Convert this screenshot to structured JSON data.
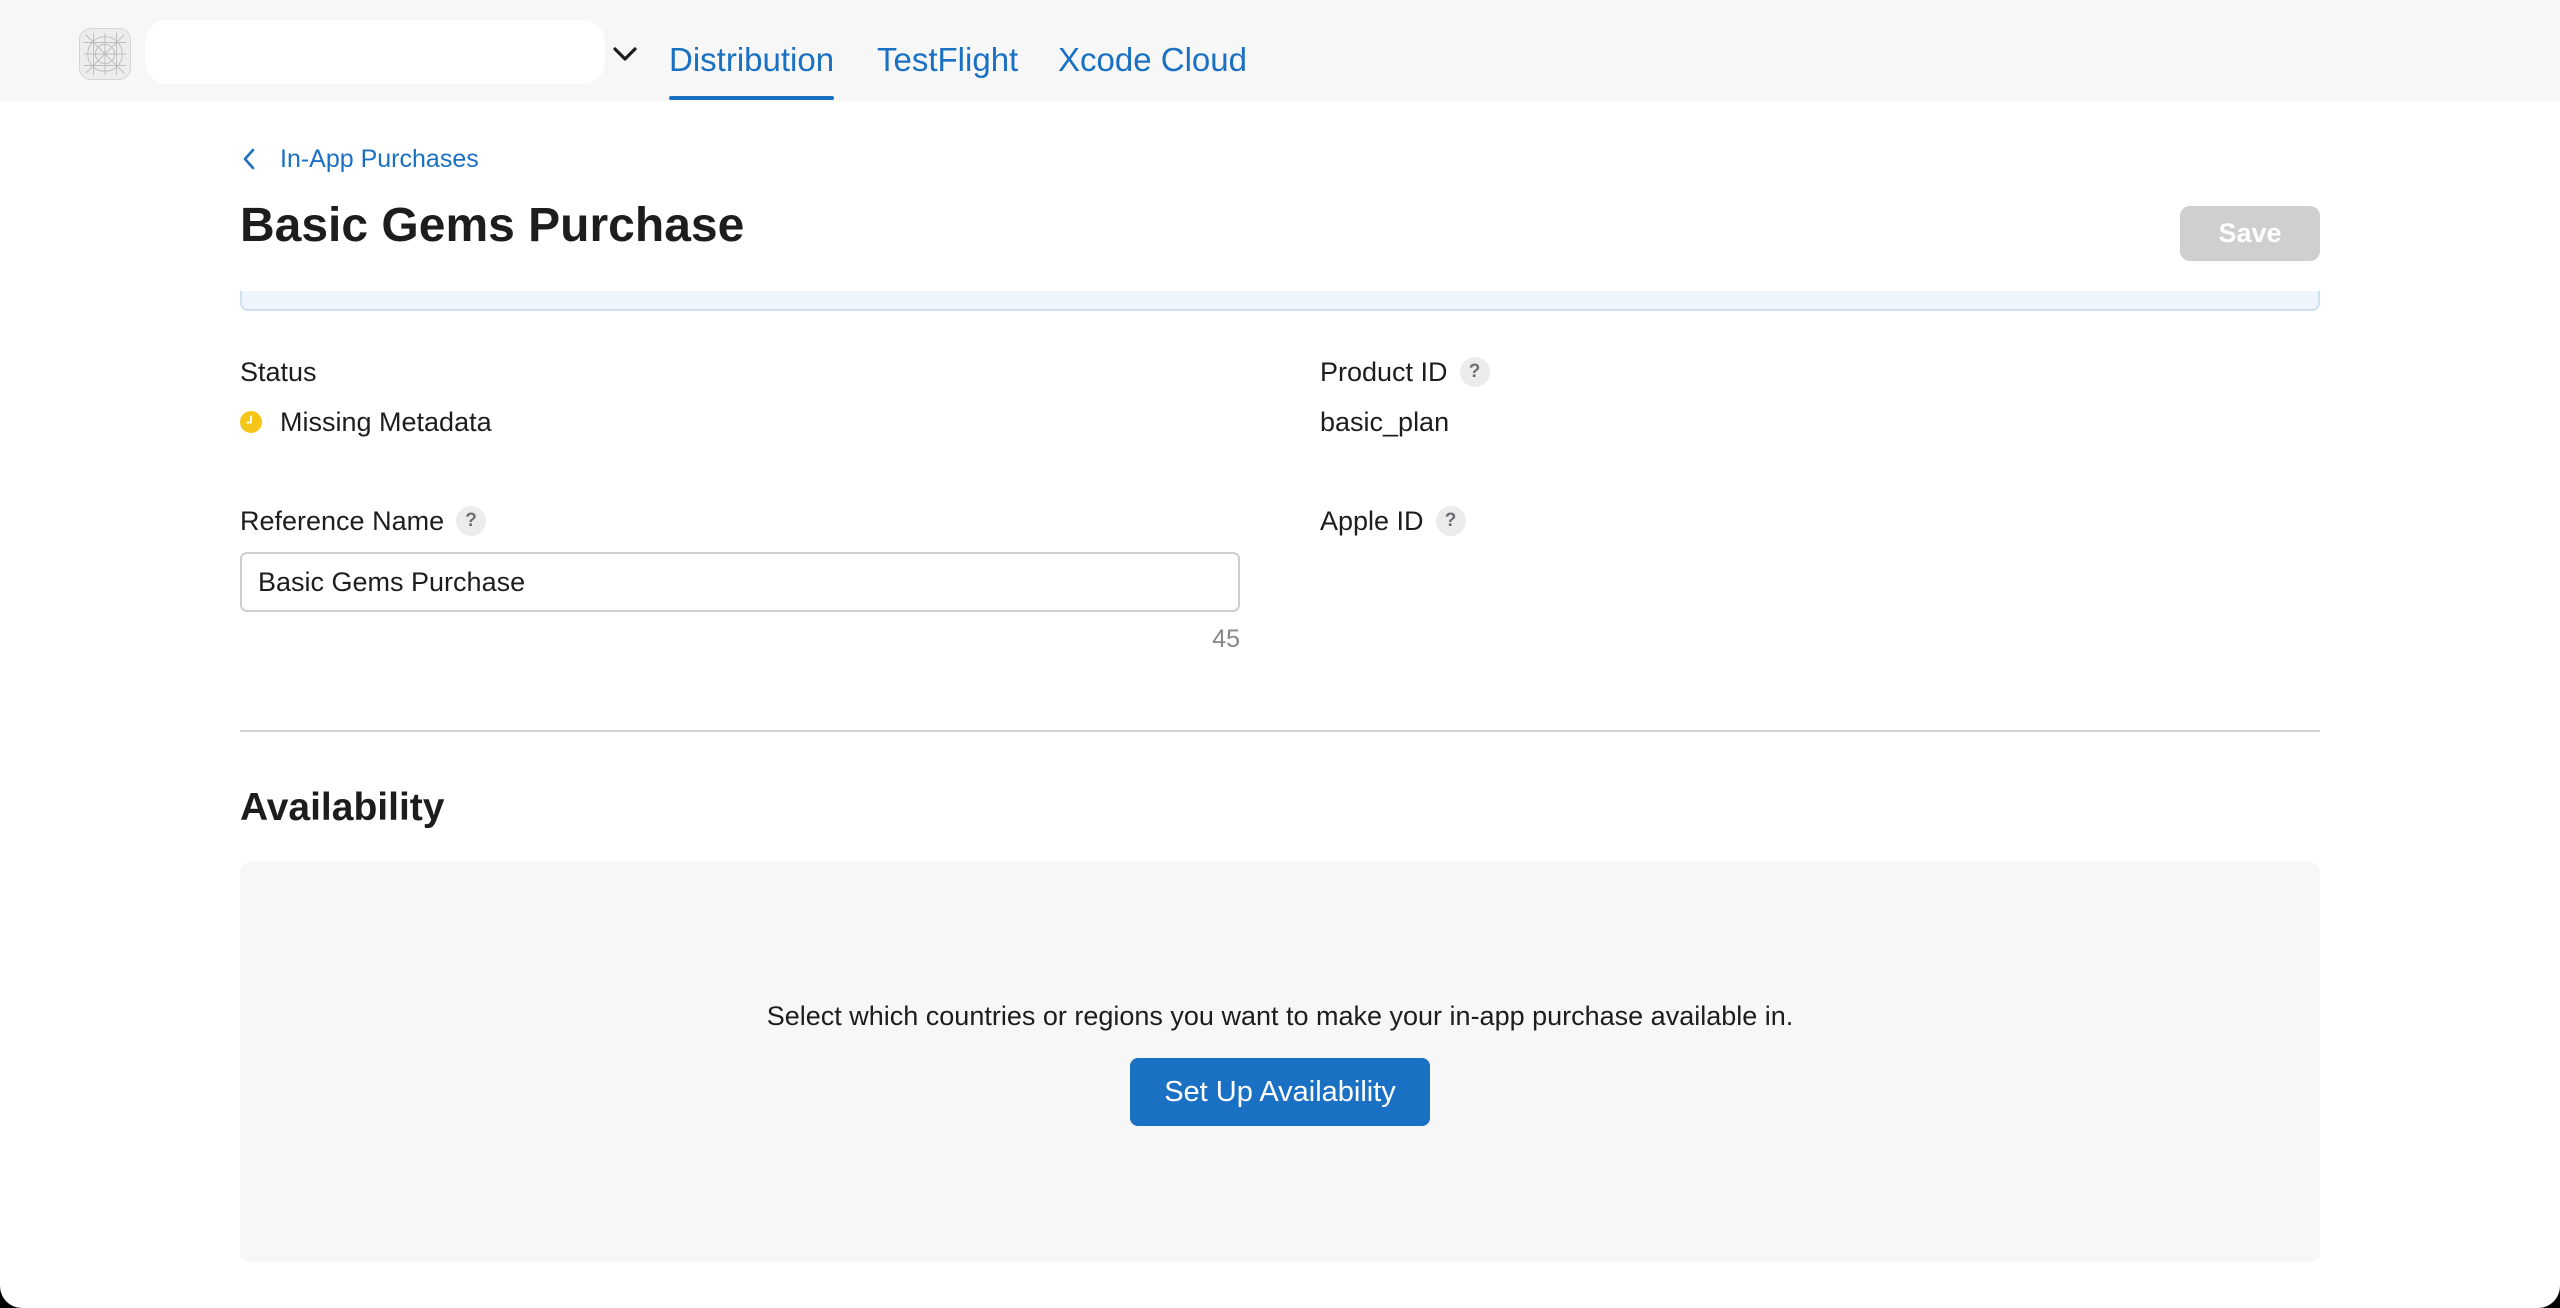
{
  "topbar": {
    "app_icon": "app-placeholder-icon",
    "app_name": "",
    "chevron_icon": "chevron-down-icon",
    "tabs": [
      {
        "label": "Distribution",
        "active": true
      },
      {
        "label": "TestFlight",
        "active": false
      },
      {
        "label": "Xcode Cloud",
        "active": false
      }
    ],
    "accent_color": "#1a70c2"
  },
  "header": {
    "breadcrumb": {
      "icon": "chevron-left-icon",
      "label": "In-App Purchases"
    },
    "title": "Basic Gems Purchase",
    "save_label": "Save"
  },
  "fields": {
    "status": {
      "label": "Status",
      "value": "Missing Metadata",
      "icon": "clock-status-icon",
      "color": "#f5c518"
    },
    "product_id": {
      "label": "Product ID",
      "help_icon": "question-mark-icon",
      "help_glyph": "?",
      "value": "basic_plan"
    },
    "reference_name": {
      "label": "Reference Name",
      "help_icon": "question-mark-icon",
      "help_glyph": "?",
      "value": "Basic Gems Purchase",
      "remaining_chars": "45"
    },
    "apple_id": {
      "label": "Apple ID",
      "help_icon": "question-mark-icon",
      "help_glyph": "?"
    }
  },
  "availability": {
    "title": "Availability",
    "description": "Select which countries or regions you want to make your in-app purchase available in.",
    "button_label": "Set Up Availability"
  }
}
